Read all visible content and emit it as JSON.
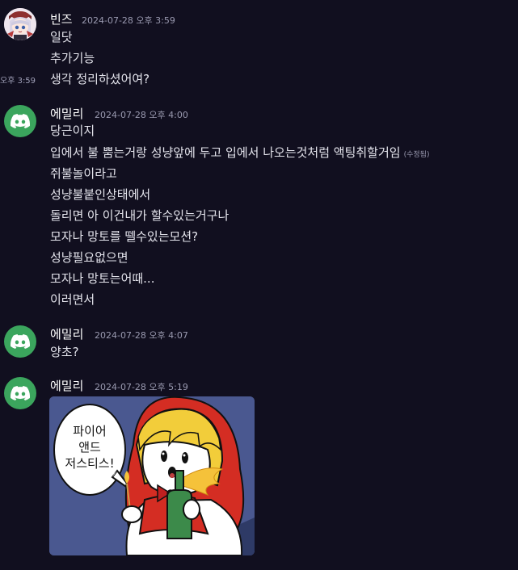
{
  "messages": [
    {
      "author": "빈즈",
      "timestamp": "2024-07-28 오후 3:59",
      "lines": [
        "일닷",
        "추가기능",
        "생각 정리하셨어여?"
      ],
      "side_timestamp": "오후 3:59"
    },
    {
      "author": "에밀리",
      "timestamp": "2024-07-28 오후 4:00",
      "lines": [
        "당근이지",
        "입에서 불 뿜는거랑 성냥앞에 두고 입에서 나오는것처럼 액팅취할거임",
        "쥐불놀이라고",
        "성냥불붙인상태에서",
        "돌리면 아 이건내가 할수있는거구나",
        "모자나 망토를 뗄수있는모션?",
        "성냥필요없으면",
        "모자나 망토는어때...",
        "이러면서"
      ],
      "edited_label": "(수정됨)"
    },
    {
      "author": "에밀리",
      "timestamp": "2024-07-28 오후 4:07",
      "lines": [
        "양초?"
      ]
    },
    {
      "author": "에밀리",
      "timestamp": "2024-07-28 오후 5:19",
      "image_speech": [
        "파이어",
        "앤드",
        "저스티스!"
      ]
    }
  ],
  "colors": {
    "background": "#110f1f",
    "discord_green": "#3ba55d",
    "hood_red": "#d42d23",
    "hair_yellow": "#f2cd3a",
    "bottle_green": "#3c8a4a"
  },
  "icons": [
    "discord-logo-icon",
    "anime-girl-avatar"
  ]
}
